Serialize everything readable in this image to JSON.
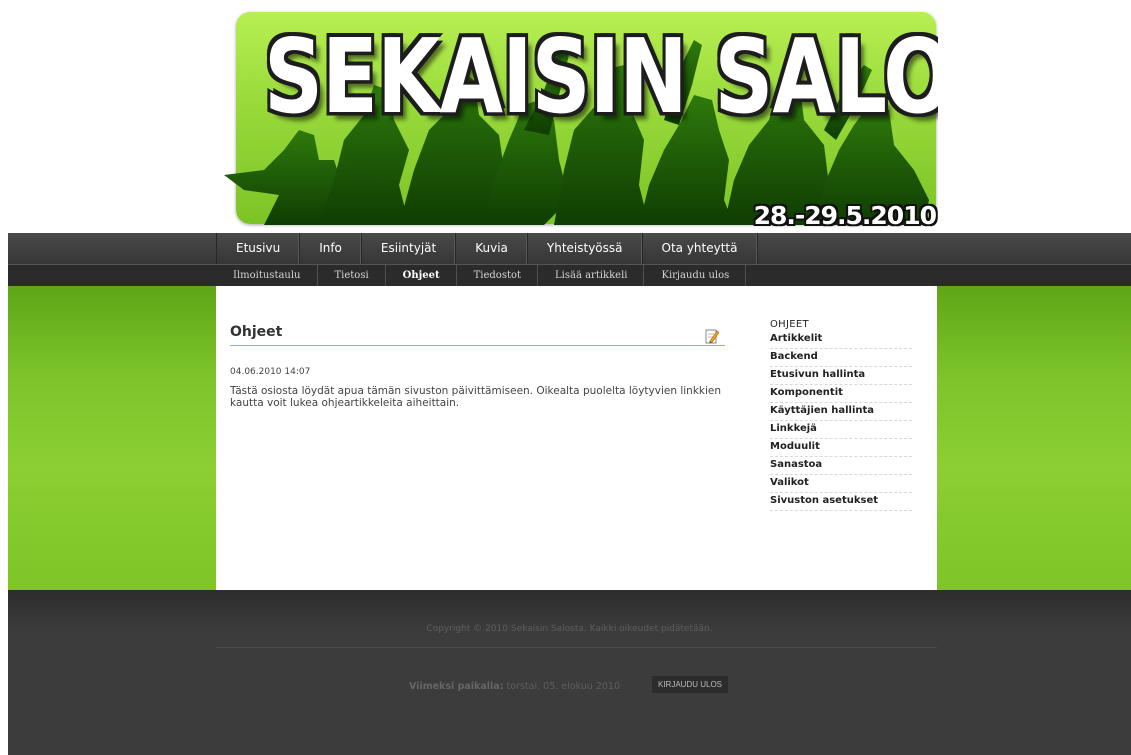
{
  "banner": {
    "title": "SEKAISIN SALOSTA",
    "dates": "28.-29.5.2010"
  },
  "main_nav": [
    {
      "label": "Etusivu"
    },
    {
      "label": "Info"
    },
    {
      "label": "Esiintyjät"
    },
    {
      "label": "Kuvia"
    },
    {
      "label": "Yhteistyössä"
    },
    {
      "label": "Ota yhteyttä"
    }
  ],
  "sub_nav": [
    {
      "label": "Ilmoitustaulu",
      "active": false
    },
    {
      "label": "Tietosi",
      "active": false
    },
    {
      "label": "Ohjeet",
      "active": true
    },
    {
      "label": "Tiedostot",
      "active": false
    },
    {
      "label": "Lisää artikkeli",
      "active": false
    },
    {
      "label": "Kirjaudu ulos",
      "active": false
    }
  ],
  "article": {
    "title": "Ohjeet",
    "edit_icon": "edit-icon",
    "date": "04.06.2010 14:07",
    "body": "Tästä osiosta löydät apua tämän sivuston päivittämiseen. Oikealta puolelta löytyvien linkkien kautta voit lukea ohjeartikkeleita aiheittain."
  },
  "side_menu": {
    "heading": "OHJEET",
    "items": [
      {
        "label": "Artikkelit"
      },
      {
        "label": "Backend"
      },
      {
        "label": "Etusivun hallinta"
      },
      {
        "label": "Komponentit"
      },
      {
        "label": "Käyttäjien hallinta"
      },
      {
        "label": "Linkkejä"
      },
      {
        "label": "Moduulit"
      },
      {
        "label": "Sanastoa"
      },
      {
        "label": "Valikot"
      },
      {
        "label": "Sivuston asetukset"
      }
    ]
  },
  "footer": {
    "copyright": "Copyright © 2010 Sekaisin Salosta. Kaikki oikeudet pidätetään.",
    "last_seen_label": "Viimeksi paikalla:",
    "last_seen_value": "torstai, 05. elokuu 2010",
    "logout_button": "KIRJAUDU ULOS"
  },
  "colors": {
    "accent_green": "#8bcf33",
    "nav_dark": "#363636",
    "footer_dark": "#3c3c3c"
  }
}
